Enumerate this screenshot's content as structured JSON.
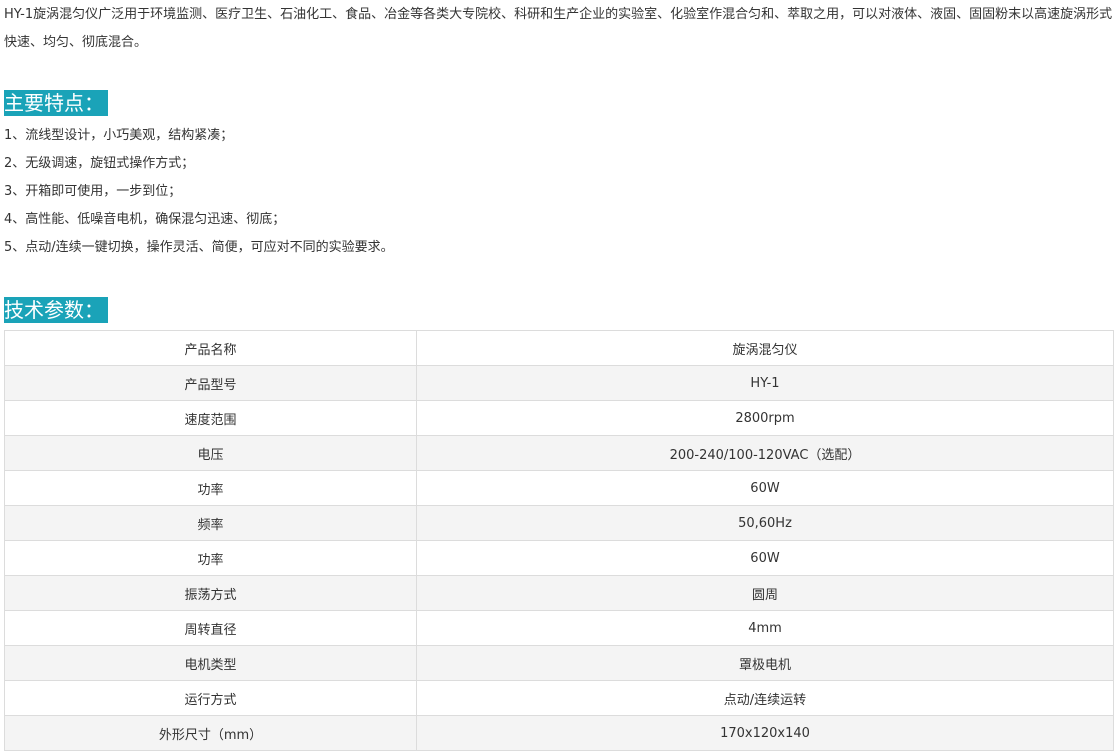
{
  "intro": "HY-1旋涡混匀仪广泛用于环境监测、医疗卫生、石油化工、食品、冶金等各类大专院校、科研和生产企业的实验室、化验室作混合匀和、萃取之用，可以对液体、液固、固固粉末以高速旋涡形式快速、均匀、彻底混合。",
  "features": {
    "title": "主要特点：",
    "items": [
      "1、流线型设计，小巧美观，结构紧凑；",
      "2、无级调速，旋钮式操作方式；",
      "3、开箱即可使用，一步到位；",
      "4、高性能、低噪音电机，确保混匀迅速、彻底；",
      "5、点动/连续一键切换，操作灵活、简便，可应对不同的实验要求。"
    ]
  },
  "specs": {
    "title": "技术参数：",
    "rows": [
      {
        "k": "产品名称",
        "v": "旋涡混匀仪"
      },
      {
        "k": "产品型号",
        "v": "HY-1"
      },
      {
        "k": "速度范围",
        "v": "2800rpm"
      },
      {
        "k": "电压",
        "v": "200-240/100-120VAC（选配）"
      },
      {
        "k": "功率",
        "v": "60W"
      },
      {
        "k": "频率",
        "v": "50,60Hz"
      },
      {
        "k": "功率",
        "v": "60W"
      },
      {
        "k": "振荡方式",
        "v": "圆周"
      },
      {
        "k": "周转直径",
        "v": "4mm"
      },
      {
        "k": "电机类型",
        "v": "罩极电机"
      },
      {
        "k": "运行方式",
        "v": "点动/连续运转"
      },
      {
        "k": "外形尺寸（mm）",
        "v": "170x120x140"
      }
    ]
  },
  "colors": {
    "accent": "#1aa3b8"
  }
}
